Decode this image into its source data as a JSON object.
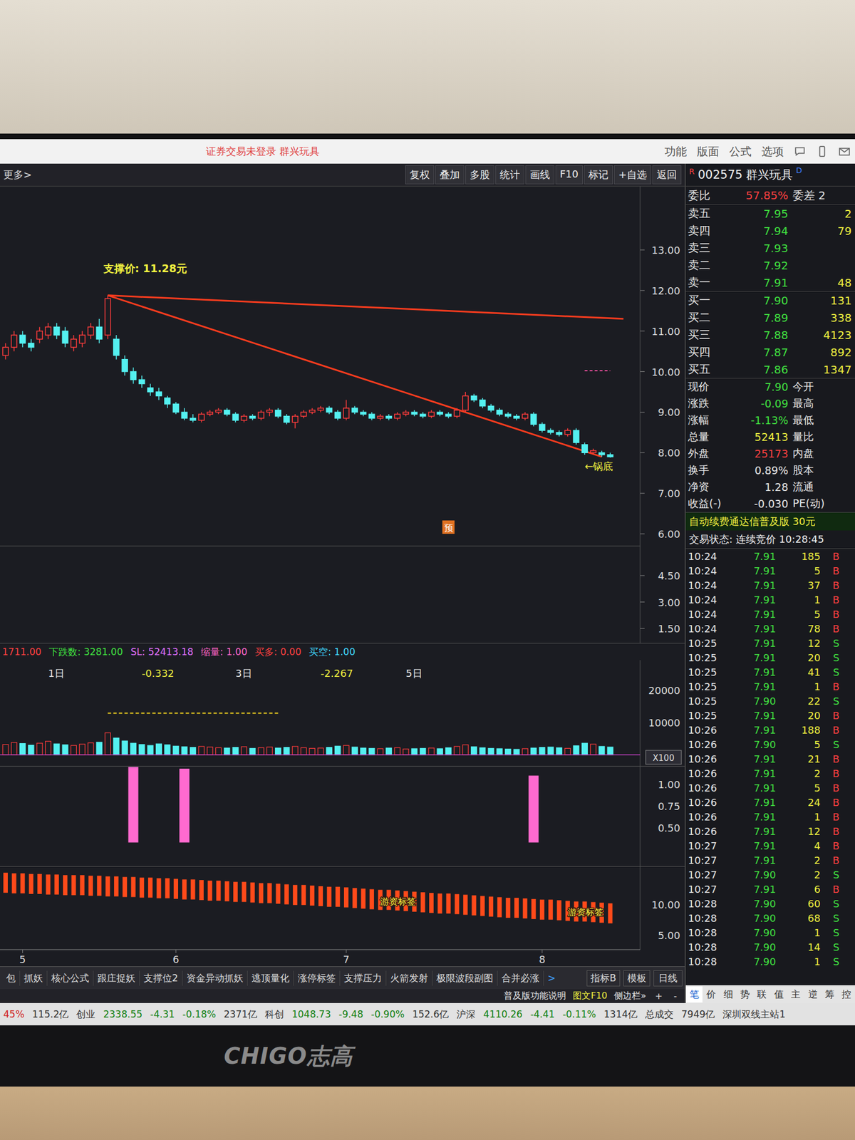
{
  "photo": {
    "bezel_logo": "CHIGO志高"
  },
  "window": {
    "title": "证券交易未登录  群兴玩具",
    "menu": [
      "功能",
      "版面",
      "公式",
      "选项"
    ]
  },
  "toolbar": {
    "more": "更多>",
    "buttons": [
      "复权",
      "叠加",
      "多股",
      "统计",
      "画线",
      "F10",
      "标记",
      "+自选",
      "返回"
    ]
  },
  "chart": {
    "main": {
      "ticks": [
        {
          "label": "13.00",
          "value": 13
        },
        {
          "label": "12.00",
          "value": 12
        },
        {
          "label": "11.00",
          "value": 11
        },
        {
          "label": "10.00",
          "value": 10
        },
        {
          "label": "9.00",
          "value": 9
        },
        {
          "label": "8.00",
          "value": 8
        },
        {
          "label": "7.00",
          "value": 7
        },
        {
          "label": "6.00",
          "value": 6
        }
      ],
      "sub_ticks": [
        {
          "label": "4.50",
          "value": 4.5
        },
        {
          "label": "3.00",
          "value": 3
        },
        {
          "label": "1.50",
          "value": 1.5
        }
      ],
      "candles": [
        [
          10.4,
          10.6,
          10.7,
          10.3
        ],
        [
          10.6,
          10.9,
          11.0,
          10.5
        ],
        [
          10.9,
          10.7,
          11.0,
          10.6
        ],
        [
          10.7,
          10.6,
          10.8,
          10.5
        ],
        [
          10.8,
          11.0,
          11.1,
          10.7
        ],
        [
          10.9,
          11.1,
          11.2,
          10.8
        ],
        [
          11.1,
          10.9,
          11.2,
          10.8
        ],
        [
          11.0,
          10.7,
          11.1,
          10.6
        ],
        [
          10.6,
          10.8,
          10.9,
          10.5
        ],
        [
          10.7,
          10.9,
          11.0,
          10.6
        ],
        [
          10.9,
          11.1,
          11.2,
          10.8
        ],
        [
          11.1,
          10.8,
          11.3,
          10.7
        ],
        [
          10.9,
          11.8,
          11.88,
          10.8
        ],
        [
          10.8,
          10.4,
          10.9,
          10.3
        ],
        [
          10.3,
          10.0,
          10.4,
          9.9
        ],
        [
          10.0,
          9.8,
          10.1,
          9.7
        ],
        [
          9.8,
          9.7,
          9.9,
          9.6
        ],
        [
          9.6,
          9.5,
          9.7,
          9.4
        ],
        [
          9.5,
          9.4,
          9.6,
          9.3
        ],
        [
          9.35,
          9.2,
          9.4,
          9.1
        ],
        [
          9.2,
          9.0,
          9.25,
          8.95
        ],
        [
          9.0,
          8.85,
          9.1,
          8.8
        ],
        [
          8.85,
          8.8,
          8.95,
          8.75
        ],
        [
          8.8,
          8.95,
          9.0,
          8.75
        ],
        [
          8.95,
          9.0,
          9.05,
          8.9
        ],
        [
          9.0,
          9.05,
          9.1,
          8.95
        ],
        [
          9.05,
          8.95,
          9.1,
          8.9
        ],
        [
          8.95,
          8.8,
          9.0,
          8.75
        ],
        [
          8.8,
          8.9,
          8.95,
          8.75
        ],
        [
          8.9,
          8.85,
          8.95,
          8.8
        ],
        [
          8.85,
          9.0,
          9.05,
          8.8
        ],
        [
          9.0,
          9.05,
          9.1,
          8.9
        ],
        [
          9.05,
          8.9,
          9.1,
          8.85
        ],
        [
          8.9,
          8.75,
          8.95,
          8.7
        ],
        [
          8.75,
          8.9,
          8.95,
          8.6
        ],
        [
          8.9,
          9.0,
          9.05,
          8.85
        ],
        [
          9.0,
          9.05,
          9.1,
          8.95
        ],
        [
          9.05,
          9.1,
          9.15,
          9.0
        ],
        [
          9.1,
          9.0,
          9.15,
          8.95
        ],
        [
          9.0,
          8.85,
          9.05,
          8.8
        ],
        [
          8.85,
          9.1,
          9.3,
          8.8
        ],
        [
          9.1,
          9.0,
          9.15,
          8.95
        ],
        [
          9.0,
          8.95,
          9.05,
          8.9
        ],
        [
          8.95,
          8.85,
          9.0,
          8.8
        ],
        [
          8.85,
          8.9,
          8.95,
          8.8
        ],
        [
          8.9,
          8.85,
          8.95,
          8.8
        ],
        [
          8.85,
          8.95,
          9.0,
          8.8
        ],
        [
          8.95,
          9.0,
          9.05,
          8.9
        ],
        [
          9.0,
          8.95,
          9.05,
          8.9
        ],
        [
          8.95,
          8.9,
          9.0,
          8.85
        ],
        [
          8.9,
          9.0,
          9.05,
          8.85
        ],
        [
          9.0,
          8.95,
          9.05,
          8.9
        ],
        [
          8.95,
          8.9,
          9.0,
          8.85
        ],
        [
          8.9,
          9.05,
          9.1,
          8.85
        ],
        [
          9.05,
          9.4,
          9.5,
          9.0
        ],
        [
          9.4,
          9.3,
          9.45,
          9.25
        ],
        [
          9.3,
          9.15,
          9.35,
          9.1
        ],
        [
          9.15,
          9.05,
          9.2,
          9.0
        ],
        [
          9.05,
          8.95,
          9.1,
          8.9
        ],
        [
          8.95,
          8.9,
          9.0,
          8.85
        ],
        [
          8.9,
          8.85,
          8.95,
          8.8
        ],
        [
          8.85,
          8.95,
          9.0,
          8.8
        ],
        [
          8.95,
          8.7,
          9.0,
          8.65
        ],
        [
          8.7,
          8.55,
          8.75,
          8.5
        ],
        [
          8.55,
          8.5,
          8.6,
          8.45
        ],
        [
          8.5,
          8.45,
          8.55,
          8.4
        ],
        [
          8.45,
          8.55,
          8.6,
          8.4
        ],
        [
          8.55,
          8.25,
          8.6,
          8.2
        ],
        [
          8.2,
          8.0,
          8.25,
          7.95
        ],
        [
          8.0,
          8.05,
          8.1,
          7.95
        ],
        [
          8.0,
          7.95,
          8.05,
          7.9
        ],
        [
          7.95,
          7.9,
          8.0,
          7.88
        ]
      ],
      "support_label": "支撑价: 11.28元",
      "support_line": {
        "index": 12,
        "from": 11.88,
        "to": 11.3
      },
      "trend_line": {
        "from_index": 12,
        "from": 11.88,
        "to_index": 70,
        "to": 7.9
      },
      "bottom_label": "←锅底",
      "forecast_badge": {
        "text": "预",
        "index": 52
      },
      "ref_mark": {
        "value": 10.02,
        "from_index": 68,
        "to_index": 71
      }
    },
    "legend": [
      {
        "text": "1711.00",
        "color": "#ff4040"
      },
      {
        "text": "下跌数: 3281.00",
        "color": "#40e040"
      },
      {
        "text": "SL: 52413.18",
        "color": "#e070ff"
      },
      {
        "text": "缩量: 1.00",
        "color": "#ff66cc"
      },
      {
        "text": "买多: 0.00",
        "color": "#ff4040"
      },
      {
        "text": "买空: 1.00",
        "color": "#40d8ff"
      }
    ],
    "volume": {
      "labels": [
        {
          "text": "1日",
          "index": 5,
          "color": "#e8e8e8"
        },
        {
          "text": "-0.332",
          "index": 16,
          "color": "#f0f040"
        },
        {
          "text": "3日",
          "index": 27,
          "color": "#e8e8e8"
        },
        {
          "text": "-2.267",
          "index": 37,
          "color": "#f0f040"
        },
        {
          "text": "5日",
          "index": 47,
          "color": "#e8e8e8"
        }
      ],
      "ticks": [
        {
          "label": "20000",
          "value": 20000
        },
        {
          "label": "10000",
          "value": 10000
        }
      ],
      "unit": "X100",
      "values": [
        3200,
        3800,
        3500,
        3000,
        3600,
        4200,
        3400,
        3100,
        2900,
        3300,
        3700,
        3900,
        6800,
        5200,
        4300,
        3600,
        3200,
        2900,
        3400,
        3100,
        2700,
        2500,
        2300,
        2600,
        2400,
        2200,
        2100,
        2300,
        2500,
        2000,
        2200,
        2400,
        2100,
        2300,
        2600,
        2200,
        2000,
        2100,
        2300,
        2700,
        2900,
        2400,
        2100,
        2000,
        1900,
        2100,
        2200,
        1800,
        1900,
        2000,
        2100,
        1900,
        2200,
        2600,
        3100,
        2500,
        2200,
        2000,
        1900,
        1800,
        1700,
        1900,
        2100,
        2300,
        2400,
        2200,
        2000,
        2800,
        3600,
        3300,
        2600,
        2400
      ],
      "dashed": {
        "from_index": 12,
        "to_index": 32,
        "value": 12900
      }
    },
    "signal": {
      "ticks": [
        {
          "label": "1.00",
          "value": 1
        },
        {
          "label": "0.75",
          "value": 0.75
        },
        {
          "label": "0.50",
          "value": 0.5
        }
      ],
      "bars": [
        {
          "index": 15,
          "value": 1.2
        },
        {
          "index": 21,
          "value": 1.18
        },
        {
          "index": 62,
          "value": 1.1
        }
      ]
    },
    "money": {
      "ticks": [
        {
          "label": "10.00",
          "value": 10
        },
        {
          "label": "5.00",
          "value": 5
        }
      ],
      "values": [
        15.2,
        15.1,
        15.1,
        15.0,
        15.0,
        14.9,
        14.9,
        14.8,
        14.8,
        14.8,
        14.7,
        14.7,
        14.6,
        14.6,
        14.5,
        14.5,
        14.4,
        14.4,
        14.3,
        14.3,
        14.2,
        14.1,
        14.1,
        14.0,
        13.9,
        13.9,
        13.8,
        13.7,
        13.7,
        13.6,
        13.5,
        13.5,
        13.4,
        13.3,
        13.2,
        13.2,
        13.1,
        13.0,
        12.9,
        12.9,
        12.8,
        12.7,
        12.6,
        12.5,
        12.4,
        12.4,
        12.3,
        12.2,
        12.1,
        12.0,
        11.9,
        11.8,
        11.8,
        11.7,
        11.6,
        11.5,
        11.4,
        11.3,
        11.2,
        11.1,
        11.1,
        11.0,
        10.9,
        10.8,
        10.8,
        10.7,
        10.6,
        10.5,
        10.5,
        10.4,
        10.3,
        10.2
      ],
      "tags": [
        {
          "text": "游资标签",
          "index": 44
        },
        {
          "text": "游资标签",
          "index": 66
        }
      ]
    },
    "dates": [
      {
        "label": "5",
        "index": 2
      },
      {
        "label": "6",
        "index": 20
      },
      {
        "label": "7",
        "index": 40
      },
      {
        "label": "8",
        "index": 63
      }
    ]
  },
  "indicator_tabs": [
    "包",
    "抓妖",
    "核心公式",
    "跟庄捉妖",
    "支撑位2",
    "资金异动抓妖",
    "逃顶量化",
    "涨停标签",
    "支撑压力",
    "火箭发射",
    "极限波段副图",
    "合并必涨"
  ],
  "tabs_more": ">",
  "tab_tools": [
    "指标B",
    "模板"
  ],
  "period": "日线",
  "zoom": [
    "+",
    "-"
  ],
  "sub_links": [
    {
      "text": "普及版功能说明",
      "color": "#e8e8e8"
    },
    {
      "text": "图文F10",
      "color": "#f0f040"
    },
    {
      "text": "侧边栏»",
      "color": "#e8e8e8"
    }
  ],
  "quote": {
    "flag": "R",
    "code": "002575",
    "name": "群兴玩具",
    "badge": "D",
    "ratio": {
      "label": "委比",
      "value": "57.85%",
      "label2": "委差",
      "value2": "2"
    },
    "asks": [
      {
        "label": "卖五",
        "price": "7.95",
        "vol": "2"
      },
      {
        "label": "卖四",
        "price": "7.94",
        "vol": "79"
      },
      {
        "label": "卖三",
        "price": "7.93",
        "vol": ""
      },
      {
        "label": "卖二",
        "price": "7.92",
        "vol": ""
      },
      {
        "label": "卖一",
        "price": "7.91",
        "vol": "48"
      }
    ],
    "bids": [
      {
        "label": "买一",
        "price": "7.90",
        "vol": "131"
      },
      {
        "label": "买二",
        "price": "7.89",
        "vol": "338"
      },
      {
        "label": "买三",
        "price": "7.88",
        "vol": "4123"
      },
      {
        "label": "买四",
        "price": "7.87",
        "vol": "892"
      },
      {
        "label": "买五",
        "price": "7.86",
        "vol": "1347"
      }
    ],
    "stats": [
      {
        "label": "现价",
        "value": "7.90",
        "color": "#40e040",
        "label2": "今开"
      },
      {
        "label": "涨跌",
        "value": "-0.09",
        "color": "#40e040",
        "label2": "最高"
      },
      {
        "label": "涨幅",
        "value": "-1.13%",
        "color": "#40e040",
        "label2": "最低"
      },
      {
        "label": "总量",
        "value": "52413",
        "color": "#f0f040",
        "label2": "量比"
      },
      {
        "label": "外盘",
        "value": "25173",
        "color": "#ff4040",
        "label2": "内盘"
      },
      {
        "label": "换手",
        "value": "0.89%",
        "color": "#e8e8e8",
        "label2": "股本"
      },
      {
        "label": "净资",
        "value": "1.28",
        "color": "#e8e8e8",
        "label2": "流通"
      },
      {
        "label": "收益(-)",
        "value": "-0.030",
        "color": "#e8e8e8",
        "label2": "PE(动)"
      }
    ],
    "banner": "自动续费通达信普及版 30元",
    "trade_state": "交易状态: 连续竞价 10:28:45",
    "ticks": [
      {
        "time": "10:24",
        "price": "7.91",
        "vol": "185",
        "side": "B"
      },
      {
        "time": "10:24",
        "price": "7.91",
        "vol": "5",
        "side": "B"
      },
      {
        "time": "10:24",
        "price": "7.91",
        "vol": "37",
        "side": "B"
      },
      {
        "time": "10:24",
        "price": "7.91",
        "vol": "1",
        "side": "B"
      },
      {
        "time": "10:24",
        "price": "7.91",
        "vol": "5",
        "side": "B"
      },
      {
        "time": "10:24",
        "price": "7.91",
        "vol": "78",
        "side": "B"
      },
      {
        "time": "10:25",
        "price": "7.91",
        "vol": "12",
        "side": "S"
      },
      {
        "time": "10:25",
        "price": "7.91",
        "vol": "20",
        "side": "S"
      },
      {
        "time": "10:25",
        "price": "7.91",
        "vol": "41",
        "side": "S"
      },
      {
        "time": "10:25",
        "price": "7.91",
        "vol": "1",
        "side": "B"
      },
      {
        "time": "10:25",
        "price": "7.90",
        "vol": "22",
        "side": "S"
      },
      {
        "time": "10:25",
        "price": "7.91",
        "vol": "20",
        "side": "B"
      },
      {
        "time": "10:26",
        "price": "7.91",
        "vol": "188",
        "side": "B"
      },
      {
        "time": "10:26",
        "price": "7.90",
        "vol": "5",
        "side": "S"
      },
      {
        "time": "10:26",
        "price": "7.91",
        "vol": "21",
        "side": "B"
      },
      {
        "time": "10:26",
        "price": "7.91",
        "vol": "2",
        "side": "B"
      },
      {
        "time": "10:26",
        "price": "7.91",
        "vol": "5",
        "side": "B"
      },
      {
        "time": "10:26",
        "price": "7.91",
        "vol": "24",
        "side": "B"
      },
      {
        "time": "10:26",
        "price": "7.91",
        "vol": "1",
        "side": "B"
      },
      {
        "time": "10:26",
        "price": "7.91",
        "vol": "12",
        "side": "B"
      },
      {
        "time": "10:27",
        "price": "7.91",
        "vol": "4",
        "side": "B"
      },
      {
        "time": "10:27",
        "price": "7.91",
        "vol": "2",
        "side": "B"
      },
      {
        "time": "10:27",
        "price": "7.90",
        "vol": "2",
        "side": "S"
      },
      {
        "time": "10:27",
        "price": "7.91",
        "vol": "6",
        "side": "B"
      },
      {
        "time": "10:28",
        "price": "7.90",
        "vol": "60",
        "side": "S"
      },
      {
        "time": "10:28",
        "price": "7.90",
        "vol": "68",
        "side": "S"
      },
      {
        "time": "10:28",
        "price": "7.90",
        "vol": "1",
        "side": "S"
      },
      {
        "time": "10:28",
        "price": "7.90",
        "vol": "14",
        "side": "S"
      },
      {
        "time": "10:28",
        "price": "7.90",
        "vol": "1",
        "side": "S"
      }
    ],
    "tabs": [
      {
        "label": "笔",
        "selected": true
      },
      {
        "label": "价",
        "selected": false
      },
      {
        "label": "细",
        "selected": false
      },
      {
        "label": "势",
        "selected": false
      },
      {
        "label": "联",
        "selected": false
      },
      {
        "label": "值",
        "selected": false
      },
      {
        "label": "主",
        "selected": false
      },
      {
        "label": "逆",
        "selected": false
      },
      {
        "label": "筹",
        "selected": false
      },
      {
        "label": "控",
        "selected": false
      }
    ]
  },
  "status_bar": [
    {
      "text": "45%",
      "color": "#d02020"
    },
    {
      "text": "115.2亿",
      "color": "#333333"
    },
    {
      "text": "创业",
      "color": "#333333"
    },
    {
      "text": "2338.55",
      "color": "#108010"
    },
    {
      "text": "-4.31",
      "color": "#108010"
    },
    {
      "text": "-0.18%",
      "color": "#108010"
    },
    {
      "text": "2371亿",
      "color": "#333333"
    },
    {
      "text": "科创",
      "color": "#333333"
    },
    {
      "text": "1048.73",
      "color": "#108010"
    },
    {
      "text": "-9.48",
      "color": "#108010"
    },
    {
      "text": "-0.90%",
      "color": "#108010"
    },
    {
      "text": "152.6亿",
      "color": "#333333"
    },
    {
      "text": "沪深",
      "color": "#333333"
    },
    {
      "text": "4110.26",
      "color": "#108010"
    },
    {
      "text": "-4.41",
      "color": "#108010"
    },
    {
      "text": "-0.11%",
      "color": "#108010"
    },
    {
      "text": "1314亿",
      "color": "#333333"
    },
    {
      "text": "总成交",
      "color": "#333333"
    },
    {
      "text": "7949亿",
      "color": "#333333"
    },
    {
      "text": "深圳双线主站1",
      "color": "#333333"
    }
  ]
}
